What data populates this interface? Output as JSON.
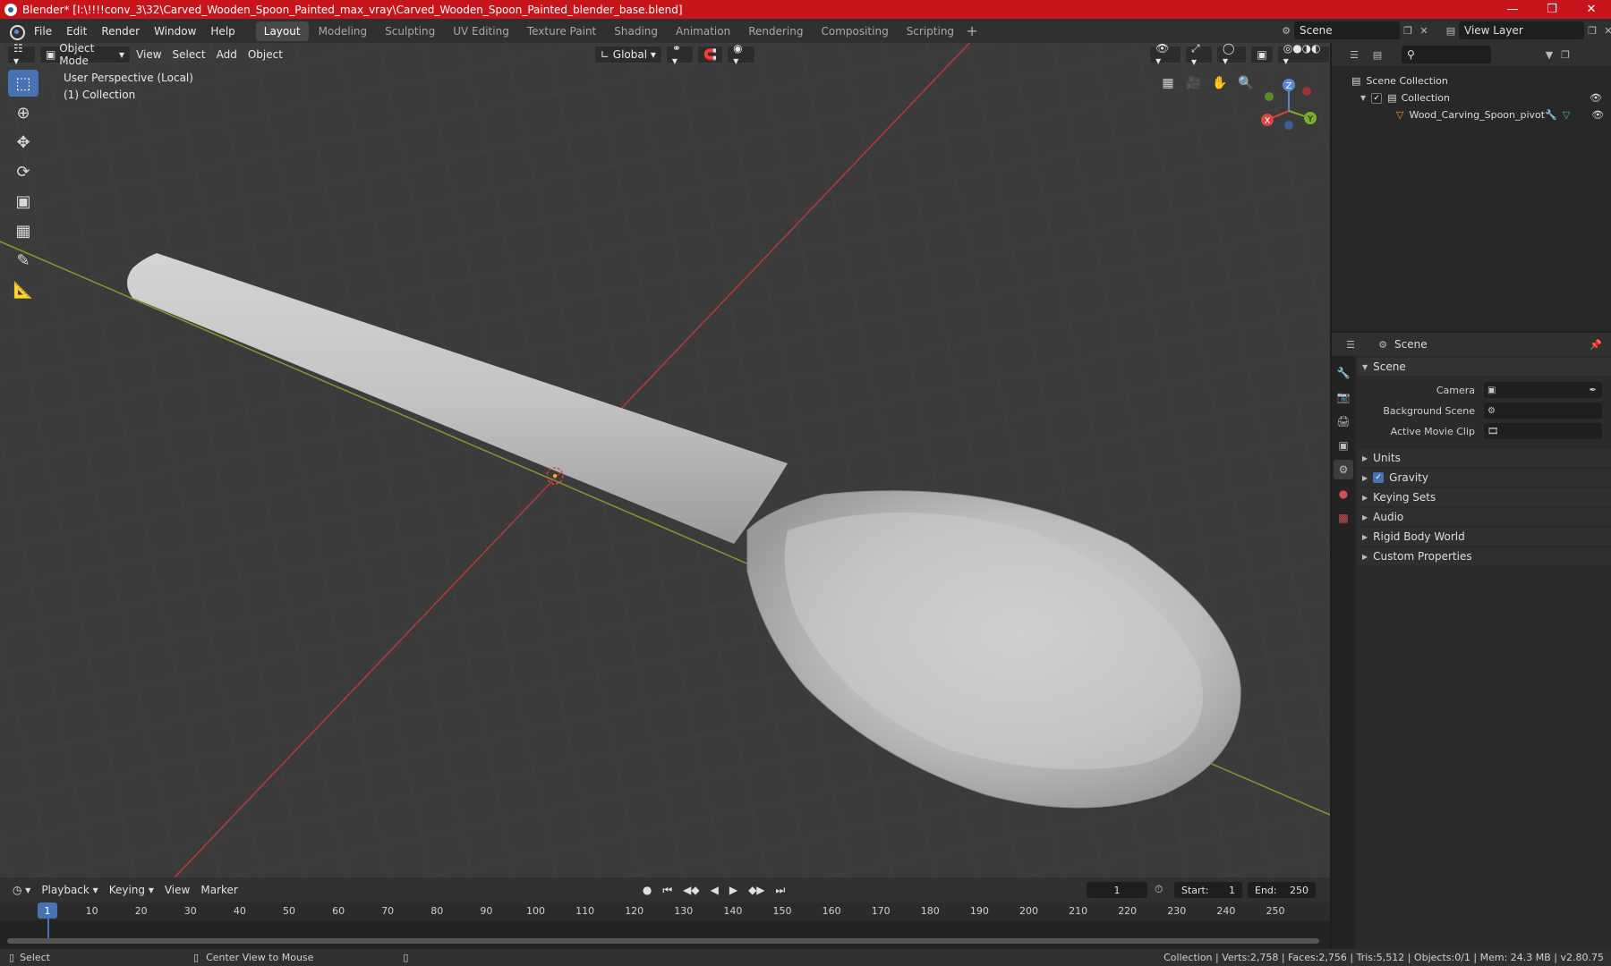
{
  "title": "Blender* [I:\\!!!!conv_3\\32\\Carved_Wooden_Spoon_Painted_max_vray\\Carved_Wooden_Spoon_Painted_blender_base.blend]",
  "menu": [
    "File",
    "Edit",
    "Render",
    "Window",
    "Help"
  ],
  "workspaces": [
    "Layout",
    "Modeling",
    "Sculpting",
    "UV Editing",
    "Texture Paint",
    "Shading",
    "Animation",
    "Rendering",
    "Compositing",
    "Scripting"
  ],
  "scene_name": "Scene",
  "view_layer": "View Layer",
  "viewport": {
    "mode": "Object Mode",
    "menus": [
      "View",
      "Select",
      "Add",
      "Object"
    ],
    "orientation": "Global",
    "info_line1": "User Perspective (Local)",
    "info_line2": "(1) Collection"
  },
  "gizmo": {
    "z": "Z",
    "y": "Y",
    "x": "X"
  },
  "outliner": {
    "root": "Scene Collection",
    "collection": "Collection",
    "object": "Wood_Carving_Spoon_pivot"
  },
  "properties": {
    "header": "Scene",
    "panel": "Scene",
    "camera_label": "Camera",
    "background_label": "Background Scene",
    "clip_label": "Active Movie Clip",
    "sections": [
      "Units",
      "Gravity",
      "Keying Sets",
      "Audio",
      "Rigid Body World",
      "Custom Properties"
    ]
  },
  "timeline": {
    "menus": [
      "Playback",
      "Keying",
      "View",
      "Marker"
    ],
    "current_frame": "1",
    "start_label": "Start:",
    "start": "1",
    "end_label": "End:",
    "end": "250",
    "ticks": [
      "10",
      "20",
      "30",
      "40",
      "50",
      "60",
      "70",
      "80",
      "90",
      "100",
      "110",
      "120",
      "130",
      "140",
      "150",
      "160",
      "170",
      "180",
      "190",
      "200",
      "210",
      "220",
      "230",
      "240",
      "250"
    ]
  },
  "status": {
    "select": "Select",
    "center": "Center View to Mouse",
    "stats": "Collection | Verts:2,758 | Faces:2,756 | Tris:5,512 | Objects:0/1 | Mem: 24.3 MB | v2.80.75"
  }
}
